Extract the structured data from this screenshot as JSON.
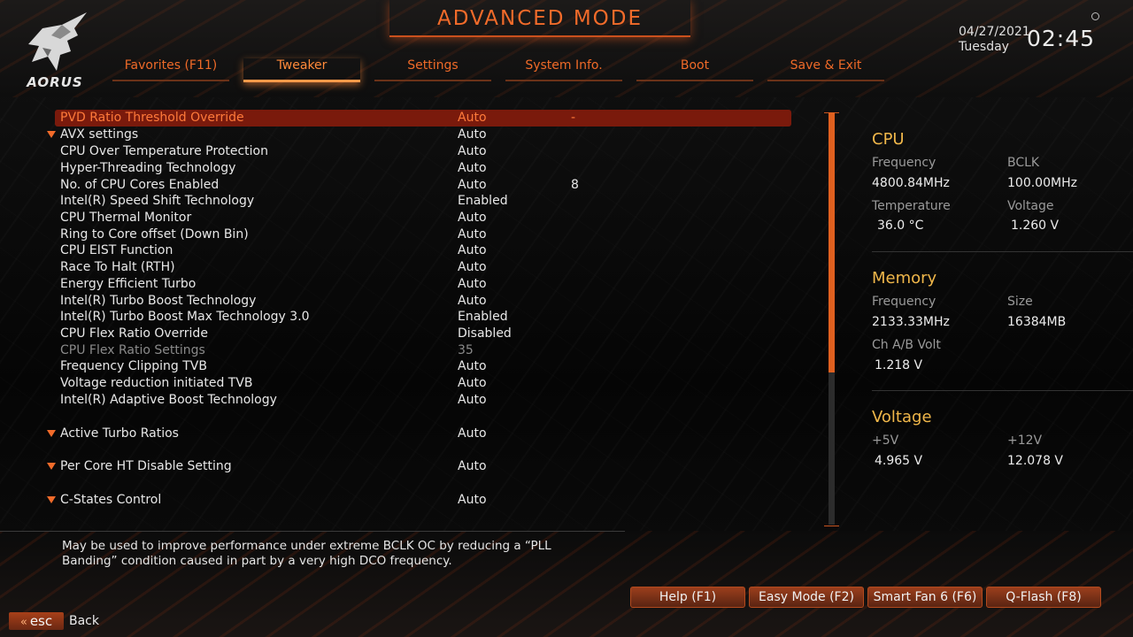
{
  "header": {
    "title": "ADVANCED MODE",
    "brand": "AORUS",
    "date": "04/27/2021",
    "weekday": "Tuesday",
    "time": "02:45"
  },
  "tabs": [
    {
      "label": "Favorites (F11)",
      "active": false
    },
    {
      "label": "Tweaker",
      "active": true
    },
    {
      "label": "Settings",
      "active": false
    },
    {
      "label": "System Info.",
      "active": false
    },
    {
      "label": "Boot",
      "active": false
    },
    {
      "label": "Save & Exit",
      "active": false
    }
  ],
  "settings": [
    {
      "label": "PVD Ratio Threshold Override",
      "value": "Auto",
      "extra": "-",
      "selected": true
    },
    {
      "label": "AVX settings",
      "value": "Auto",
      "extra": "",
      "expandable": true
    },
    {
      "label": "CPU Over Temperature Protection",
      "value": "Auto",
      "extra": ""
    },
    {
      "label": "Hyper-Threading Technology",
      "value": "Auto",
      "extra": ""
    },
    {
      "label": "No. of CPU Cores Enabled",
      "value": "Auto",
      "extra": "8"
    },
    {
      "label": "Intel(R) Speed Shift Technology",
      "value": "Enabled",
      "extra": ""
    },
    {
      "label": "CPU Thermal Monitor",
      "value": "Auto",
      "extra": ""
    },
    {
      "label": "Ring to Core offset (Down Bin)",
      "value": "Auto",
      "extra": ""
    },
    {
      "label": "CPU EIST Function",
      "value": "Auto",
      "extra": ""
    },
    {
      "label": "Race To Halt (RTH)",
      "value": "Auto",
      "extra": ""
    },
    {
      "label": "Energy Efficient Turbo",
      "value": "Auto",
      "extra": ""
    },
    {
      "label": "Intel(R) Turbo Boost Technology",
      "value": "Auto",
      "extra": ""
    },
    {
      "label": "Intel(R) Turbo Boost Max Technology 3.0",
      "value": "Enabled",
      "extra": ""
    },
    {
      "label": "CPU Flex Ratio Override",
      "value": "Disabled",
      "extra": ""
    },
    {
      "label": "CPU Flex Ratio Settings",
      "value": "35",
      "extra": "",
      "disabled": true
    },
    {
      "label": "Frequency Clipping TVB",
      "value": "Auto",
      "extra": ""
    },
    {
      "label": "Voltage reduction initiated TVB",
      "value": "Auto",
      "extra": ""
    },
    {
      "label": "Intel(R) Adaptive Boost Technology",
      "value": "Auto",
      "extra": ""
    },
    {
      "label": "Active Turbo Ratios",
      "value": "Auto",
      "extra": "",
      "expandable": true
    },
    {
      "label": "Per Core HT Disable Setting",
      "value": "Auto",
      "extra": "",
      "expandable": true
    },
    {
      "label": "C-States Control",
      "value": "Auto",
      "extra": "",
      "expandable": true
    }
  ],
  "scrollbar": {
    "position_fraction": 0.0,
    "visible_fraction": 0.63
  },
  "panel": {
    "cpu": {
      "heading": "CPU",
      "frequency_label": "Frequency",
      "frequency_value": "4800.84MHz",
      "bclk_label": "BCLK",
      "bclk_value": "100.00MHz",
      "temperature_label": "Temperature",
      "temperature_value": "36.0 °C",
      "voltage_label": "Voltage",
      "voltage_value": "1.260 V"
    },
    "memory": {
      "heading": "Memory",
      "frequency_label": "Frequency",
      "frequency_value": "2133.33MHz",
      "size_label": "Size",
      "size_value": "16384MB",
      "volt_label": "Ch A/B Volt",
      "volt_value": "1.218 V"
    },
    "voltage": {
      "heading": "Voltage",
      "v5_label": "+5V",
      "v5_value": "4.965 V",
      "v12_label": "+12V",
      "v12_value": "12.078 V"
    }
  },
  "help_text": "May be used to improve performance under extreme BCLK OC by reducing a “PLL Banding” condition caused in part by a very high DCO frequency.",
  "footer": {
    "buttons": [
      "Help (F1)",
      "Easy Mode (F2)",
      "Smart Fan 6 (F6)",
      "Q-Flash (F8)"
    ],
    "esc_label": "esc",
    "back_label": "Back"
  },
  "colors": {
    "accent": "#f26b2a",
    "panel_heading": "#f0b74a",
    "selected_row": "#7a1a0c"
  },
  "icons": {
    "logo": "aorus-eagle-logo",
    "expand": "triangle-down-icon",
    "esc": "double-chevron-left-icon"
  }
}
